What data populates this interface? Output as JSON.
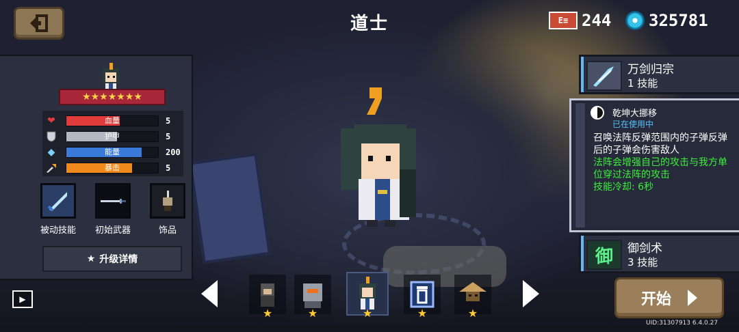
{
  "header": {
    "title": "道士",
    "energy_icon_text": "E≡",
    "energy_value": "244",
    "gem_value": "325781"
  },
  "hero_panel": {
    "stars": "★★★★★★★",
    "stats": [
      {
        "label": "血量",
        "value": "5",
        "fill": 0.58,
        "color": "#e03c3c",
        "icon": "heart-icon"
      },
      {
        "label": "护甲",
        "value": "5",
        "fill": 0.55,
        "color": "#b4b8c2",
        "icon": "shield-icon"
      },
      {
        "label": "能量",
        "value": "200",
        "fill": 0.82,
        "color": "#3a7ad8",
        "icon": "diamond-icon"
      },
      {
        "label": "暴击",
        "value": "5",
        "fill": 0.72,
        "color": "#f08a1c",
        "icon": "crit-icon"
      }
    ],
    "equipment": [
      {
        "label": "被动技能",
        "icon": "passive-skill-icon"
      },
      {
        "label": "初始武器",
        "icon": "sword-icon"
      },
      {
        "label": "饰品",
        "icon": "accessory-icon"
      }
    ],
    "upgrade_label": "升级详情"
  },
  "skills": {
    "skill1": {
      "name": "万剑归宗",
      "level": "1 技能"
    },
    "active": {
      "name": "乾坤大挪移",
      "status": "已在使用中",
      "desc_white": "召唤法阵反弹范围内的子弹反弹后的子弹会伤害敌人",
      "desc_green": "法阵会增强自己的攻击与我方单位穿过法阵的攻击",
      "cooldown": "技能冷却: 6秒"
    },
    "skill3": {
      "name": "御剑术",
      "level": "3 技能",
      "icon_text": "御"
    }
  },
  "selector": {
    "start_label": "开始"
  },
  "footer": {
    "uid": "UID:31307913 6.4.0.27"
  },
  "colors": {
    "accent_blue": "#54c2ff",
    "accent_green": "#3cf03c",
    "star_gold": "#ffcc33",
    "button_tan": "#9a7f5a"
  }
}
